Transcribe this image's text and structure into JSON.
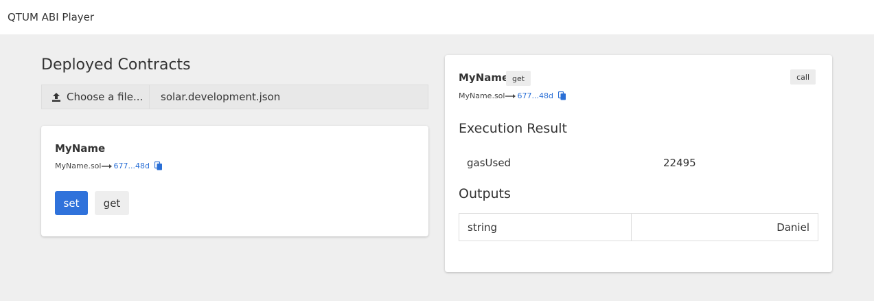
{
  "app": {
    "title": "QTUM ABI Player"
  },
  "deployed": {
    "title": "Deployed Contracts",
    "file_picker": {
      "button_label": "Choose a file...",
      "file_name": "solar.development.json"
    },
    "contract": {
      "name": "MyName",
      "source": "MyName.sol",
      "address": "677...48d",
      "methods": [
        {
          "label": "set"
        },
        {
          "label": "get"
        }
      ]
    }
  },
  "call_panel": {
    "contract_name": "MyName",
    "method_tag": "get",
    "call_tag": "call",
    "source": "MyName.sol",
    "address": "677...48d",
    "execution": {
      "title": "Execution Result",
      "rows": [
        {
          "key": "gasUsed",
          "value": "22495"
        }
      ]
    },
    "outputs": {
      "title": "Outputs",
      "rows": [
        {
          "type": "string",
          "value": "Daniel"
        }
      ]
    }
  },
  "colors": {
    "primary": "#2f72db",
    "link": "#2a6fd6",
    "background": "#efefef"
  },
  "icons": {
    "upload": "upload-icon",
    "copy": "copy-icon",
    "arrow": "long-arrow-right-icon"
  }
}
